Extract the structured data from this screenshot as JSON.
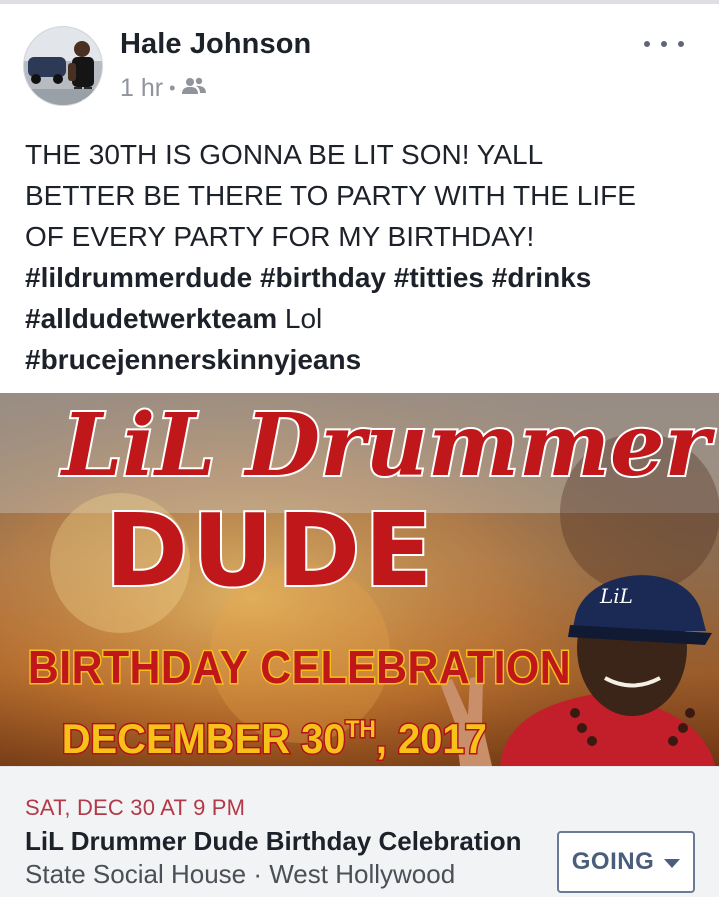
{
  "post": {
    "author": "Hale Johnson",
    "time": "1 hr",
    "separator": "•",
    "audience_icon": "friends-icon",
    "more_icon": "more-options-icon",
    "text_lines": {
      "l1": "THE 30TH IS GONNA BE LIT SON! YALL",
      "l2": "BETTER BE THERE TO PARTY WITH THE LIFE",
      "l3": "OF EVERY PARTY FOR MY BIRTHDAY!",
      "l4_tags": "#lildrummerdude #birthday #titties #drinks",
      "l5_tag": "#alldudetwerkteam",
      "l5_rest": " Lol",
      "l6_tag": "#brucejennerskinnyjeans"
    }
  },
  "banner": {
    "line1": "LiL Drummer",
    "line2": "DUDE",
    "line3": "BIRTHDAY CELEBRATION",
    "line4_main": "DECEMBER 30",
    "line4_sup": "TH",
    "line4_end": ", 2017",
    "hat_text": "LiL",
    "colors": {
      "title_red": "#c0181a",
      "title_outline": "#ffffff",
      "date_yellow": "#f6c21a",
      "date_outline": "#b3111a"
    }
  },
  "event": {
    "date": "SAT, DEC 30 AT 9 PM",
    "title": "LiL Drummer Dude Birthday Celebration",
    "location": "State Social House · West Hollywood",
    "button_label": "GOING",
    "button_icon": "caret-down-icon"
  },
  "colors": {
    "event_date": "#b23a48",
    "button_text": "#4b5d7d",
    "meta_gray": "#90949c"
  }
}
